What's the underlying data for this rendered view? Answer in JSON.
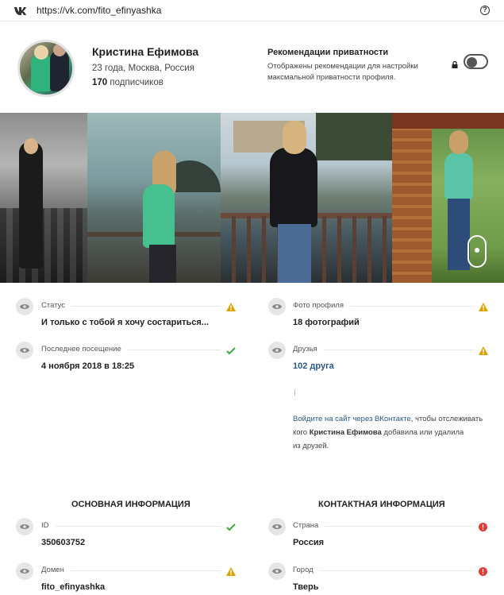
{
  "url_bar": {
    "logo": "vk-logo-icon",
    "url": "https://vk.com/fito_efinyashka",
    "help": "?"
  },
  "profile": {
    "name": "Кристина Ефимова",
    "meta": "23 года, Москва, Россия",
    "followers_count": "170",
    "followers_label": "подписчиков"
  },
  "privacy": {
    "title": "Рекомендации приватности",
    "description": "Отображены рекомендации для настройки максмальной приватности профиля.",
    "toggle_on": false
  },
  "photos": {
    "count_shown": 4
  },
  "fields": {
    "status": {
      "label": "Статус",
      "value": "И только с тобой я хочу состариться...",
      "status": "warning"
    },
    "last_seen": {
      "label": "Последнее посещение",
      "value": "4 ноября 2018 в 18:25",
      "status": "ok"
    },
    "profile_photos": {
      "label": "Фото профиля",
      "value": "18 фотографий",
      "status": "warning"
    },
    "friends": {
      "label": "Друзья",
      "value": "102 друга",
      "status": "warning"
    },
    "id": {
      "label": "ID",
      "value": "350603752",
      "status": "ok"
    },
    "domain": {
      "label": "Домен",
      "value": "fito_efinyashka",
      "status": "warning"
    },
    "country": {
      "label": "Страна",
      "value": "Россия",
      "status": "error"
    },
    "city": {
      "label": "Город",
      "value": "Тверь",
      "status": "error"
    }
  },
  "friends_note": {
    "link": "Войдите на сайт через ВКонтакте",
    "text1": ", чтобы отслеживать",
    "text2": "кого ",
    "name": "Кристина Ефимова",
    "text3": " добавила или удалила",
    "text4": "из друзей."
  },
  "sections": {
    "basic": "ОСНОВНАЯ ИНФОРМАЦИЯ",
    "contact": "КОНТАКТНАЯ ИНФОРМАЦИЯ"
  },
  "colors": {
    "warning": "#d9a400",
    "ok": "#3aa83a",
    "error": "#e53935",
    "link": "#2a5885"
  }
}
